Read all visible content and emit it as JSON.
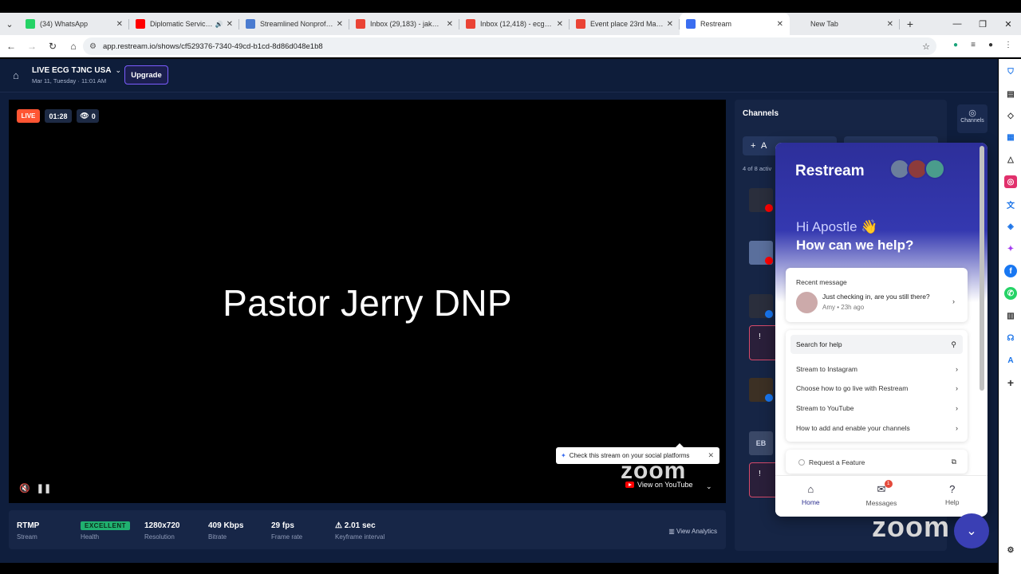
{
  "browser": {
    "tabs": [
      {
        "title": "(34) WhatsApp",
        "icon": "whatsapp-icon",
        "color": "#25d366"
      },
      {
        "title": "Diplomatic Service U...",
        "icon": "youtube-icon",
        "color": "#ff0000",
        "audio": true
      },
      {
        "title": "Streamlined Nonprofit &...",
        "icon": "settings-icon",
        "color": "#4a7bd0"
      },
      {
        "title": "Inbox (29,183) - jakwab7...",
        "icon": "gmail-icon",
        "color": "#ea4335"
      },
      {
        "title": "Inbox (12,418) - ecgmass...",
        "icon": "gmail-icon",
        "color": "#ea4335"
      },
      {
        "title": "Event place 23rd May - 2...",
        "icon": "gmail-icon",
        "color": "#ea4335"
      },
      {
        "title": "Restream",
        "icon": "restream-icon",
        "color": "#3a6df0",
        "active": true
      },
      {
        "title": "New Tab",
        "icon": "",
        "color": ""
      }
    ],
    "url": "app.restream.io/shows/cf529376-7340-49cd-b1cd-8d86d048e1b8"
  },
  "header": {
    "show_title": "LIVE ECG TJNC USA",
    "show_date": "Mar 11, Tuesday · 11:01 AM",
    "upgrade_label": "Upgrade"
  },
  "stage": {
    "live_label": "LIVE",
    "timer": "01:28",
    "viewers": "0",
    "name_overlay": "Pastor Jerry DNP",
    "watermark": "zoom",
    "view_on_label": "View on YouTube"
  },
  "stats": [
    {
      "value": "RTMP",
      "label": "Stream"
    },
    {
      "value": "EXCELLENT",
      "label": "Health"
    },
    {
      "value": "1280x720",
      "label": "Resolution"
    },
    {
      "value": "409 Kbps",
      "label": "Bitrate"
    },
    {
      "value": "29 fps",
      "label": "Frame rate"
    },
    {
      "value": "2.01 sec",
      "label": "Keyframe interval"
    }
  ],
  "analytics_label": "View Analytics",
  "tooltip_text": "Check this stream on your social platforms",
  "channels": {
    "title": "Channels",
    "add_label": "A",
    "count": "4 of 8 activ",
    "alert": "!",
    "eb": "EB",
    "rail_label": "Channels"
  },
  "widget": {
    "logo": "Restream",
    "greeting": "Hi Apostle 👋",
    "subtitle": "How can we help?",
    "recent_title": "Recent message",
    "recent_msg": "Just checking in, are you still there?",
    "recent_meta": "Amy • 23h ago",
    "search_label": "Search for help",
    "help_items": [
      "Stream to Instagram",
      "Choose how to go live with Restream",
      "Stream to YouTube",
      "How to add and enable your channels"
    ],
    "request_label": "Request a Feature",
    "footer": [
      {
        "label": "Home"
      },
      {
        "label": "Messages",
        "badge": "1"
      },
      {
        "label": "Help"
      }
    ]
  },
  "zoom_watermark_2": "zoom",
  "colors": {
    "app_bg": "#0f1e3d",
    "accent": "#3438b0",
    "live": "#ff5533",
    "health": "#20b070",
    "warning": "#f5b400"
  }
}
